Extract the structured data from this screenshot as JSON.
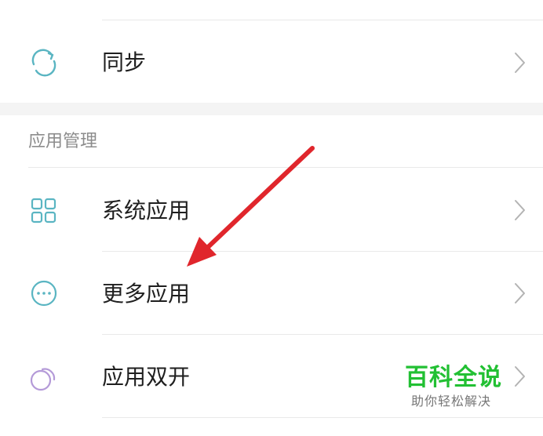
{
  "sync_row": {
    "label": "同步",
    "icon": "sync-icon"
  },
  "section": {
    "title": "应用管理"
  },
  "rows": [
    {
      "label": "系统应用",
      "icon": "grid-apps-icon"
    },
    {
      "label": "更多应用",
      "icon": "more-dots-icon"
    },
    {
      "label": "应用双开",
      "icon": "dual-apps-icon"
    }
  ],
  "watermark": {
    "title": "百科全说",
    "subtitle": "助你轻松解决"
  },
  "colors": {
    "accent_teal": "#5ab5c2",
    "arrow_red": "#e0262c",
    "dual_purple": "#b49ad8",
    "watermark_green": "#22c033"
  }
}
